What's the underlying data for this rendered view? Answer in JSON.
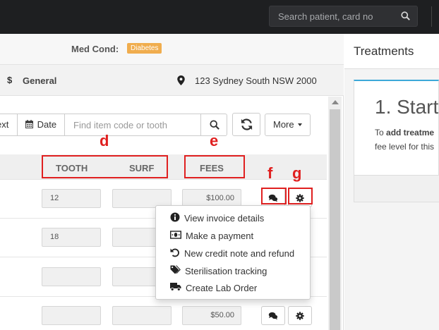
{
  "navbar": {
    "search_placeholder": "Search patient, card no"
  },
  "patient": {
    "medcond_label": "Med Cond:",
    "medcond_badge": "Diabetes",
    "fee_level": "General",
    "address": "123 Sydney South NSW 2000"
  },
  "toolbar": {
    "text_label": "ext",
    "date_label": "Date",
    "item_search_placeholder": "Find item code or tooth",
    "more_label": "More"
  },
  "table": {
    "headers": {
      "tooth": "TOOTH",
      "surf": "SURF",
      "fees": "FEES"
    },
    "rows": [
      {
        "tooth": "12",
        "surf": "",
        "fee": "$100.00"
      },
      {
        "tooth": "18",
        "surf": "",
        "fee": ""
      },
      {
        "tooth": "",
        "surf": "",
        "fee": ""
      },
      {
        "tooth": "",
        "surf": "",
        "fee": "$50.00"
      }
    ]
  },
  "annotations": {
    "d": "d",
    "e": "e",
    "f": "f",
    "g": "g"
  },
  "menu": {
    "items": [
      {
        "label": "View invoice details",
        "icon": "info-circle-icon"
      },
      {
        "label": "Make a payment",
        "icon": "money-icon"
      },
      {
        "label": "New credit note and refund",
        "icon": "undo-icon"
      },
      {
        "label": "Sterilisation tracking",
        "icon": "tags-icon"
      },
      {
        "label": "Create Lab Order",
        "icon": "truck-icon"
      }
    ]
  },
  "right_panel": {
    "title": "Treatments",
    "heading": "1. Start",
    "line1_prefix": "To ",
    "line1_bold": "add treatme",
    "line2": "fee level for this"
  },
  "colors": {
    "navbar": "#1e1f21",
    "badge": "#f0ad4e",
    "annotation": "#e02020",
    "accent": "#3da9d8"
  }
}
